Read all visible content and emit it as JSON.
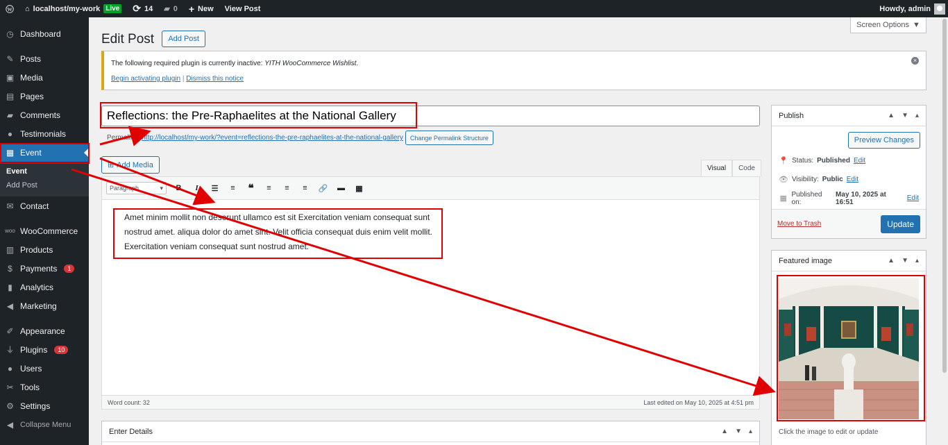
{
  "adminbar": {
    "site_name": "localhost/my-work",
    "live": "Live",
    "updates_count": "14",
    "comments_count": "0",
    "new_label": "New",
    "view_post": "View Post",
    "howdy": "Howdy, admin"
  },
  "sidebar": {
    "items": [
      {
        "label": "Dashboard",
        "icon": "dashboard-icon"
      },
      {
        "label": "Posts",
        "icon": "pin-icon"
      },
      {
        "label": "Media",
        "icon": "media-icon"
      },
      {
        "label": "Pages",
        "icon": "pages-icon"
      },
      {
        "label": "Comments",
        "icon": "comments-icon"
      },
      {
        "label": "Testimonials",
        "icon": "user-icon"
      },
      {
        "label": "Event",
        "icon": "calendar-icon"
      },
      {
        "label": "Contact",
        "icon": "mail-icon"
      },
      {
        "label": "WooCommerce",
        "icon": "woo-icon"
      },
      {
        "label": "Products",
        "icon": "archive-icon"
      },
      {
        "label": "Payments",
        "icon": "dollar-icon",
        "badge": "1"
      },
      {
        "label": "Analytics",
        "icon": "chart-icon"
      },
      {
        "label": "Marketing",
        "icon": "megaphone-icon"
      },
      {
        "label": "Appearance",
        "icon": "brush-icon"
      },
      {
        "label": "Plugins",
        "icon": "plug-icon",
        "badge": "10"
      },
      {
        "label": "Users",
        "icon": "users-icon"
      },
      {
        "label": "Tools",
        "icon": "wrench-icon"
      },
      {
        "label": "Settings",
        "icon": "settings-icon"
      },
      {
        "label": "Collapse Menu",
        "icon": "collapse-icon"
      }
    ],
    "submenu": [
      "Event",
      "Add Post"
    ]
  },
  "header": {
    "title": "Edit Post",
    "add_post": "Add Post",
    "screen_options": "Screen Options"
  },
  "notice": {
    "text_prefix": "The following required plugin is currently inactive: ",
    "plugin": "YITH WooCommerce Wishlist",
    "text_suffix": ".",
    "activate_link": "Begin activating plugin",
    "separator": "|",
    "dismiss_link": "Dismiss this notice"
  },
  "post": {
    "title": "Reflections: the Pre-Raphaelites at the National Gallery",
    "permalink_label": "Permalink:",
    "permalink_url": "http://localhost/my-work/?event=reflections-the-pre-raphaelites-at-the-national-gallery",
    "change_permalink": "Change Permalink Structure"
  },
  "editor": {
    "add_media": "Add Media",
    "tab_visual": "Visual",
    "tab_code": "Code",
    "format": "Paragraph",
    "content": "Amet minim mollit non deserunt ullamco est sit Exercitation veniam consequat sunt nostrud amet. aliqua dolor do amet sint. Velit officia consequat duis enim velit mollit. Exercitation veniam consequat sunt nostrud amet.",
    "word_count": "Word count: 32",
    "last_edited": "Last edited on May 10, 2025 at 4:51 pm"
  },
  "details": {
    "title": "Enter Details"
  },
  "publish": {
    "title": "Publish",
    "preview": "Preview Changes",
    "status_label": "Status:",
    "status_value": "Published",
    "visibility_label": "Visibility:",
    "visibility_value": "Public",
    "published_label": "Published on:",
    "published_value": "May 10, 2025 at 16:51",
    "edit": "Edit",
    "trash": "Move to Trash",
    "update": "Update"
  },
  "featured": {
    "title": "Featured image",
    "caption": "Click the image to edit or update"
  },
  "colors": {
    "accent": "#2271b1",
    "annotation": "#e00000",
    "admin_dark": "#1d2327"
  }
}
